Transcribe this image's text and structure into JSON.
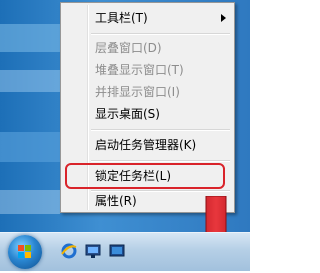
{
  "menu": {
    "items": [
      {
        "label": "工具栏(T)",
        "enabled": true,
        "submenu": true
      },
      {
        "label": "层叠窗口(D)",
        "enabled": false
      },
      {
        "label": "堆叠显示窗口(T)",
        "enabled": false
      },
      {
        "label": "并排显示窗口(I)",
        "enabled": false
      },
      {
        "label": "显示桌面(S)",
        "enabled": true
      },
      {
        "label": "启动任务管理器(K)",
        "enabled": true
      },
      {
        "label": "锁定任务栏(L)",
        "enabled": true,
        "checked": false,
        "highlighted": true
      },
      {
        "label": "属性(R)",
        "enabled": true
      }
    ]
  },
  "colors": {
    "highlight_ring": "#d9232a",
    "arrow": "#d9232a",
    "disabled_text": "#8d8d8d"
  },
  "taskbar": {
    "icons": [
      "windows-start-orb",
      "internet-explorer-icon",
      "network-icon",
      "show-desktop-icon"
    ]
  }
}
